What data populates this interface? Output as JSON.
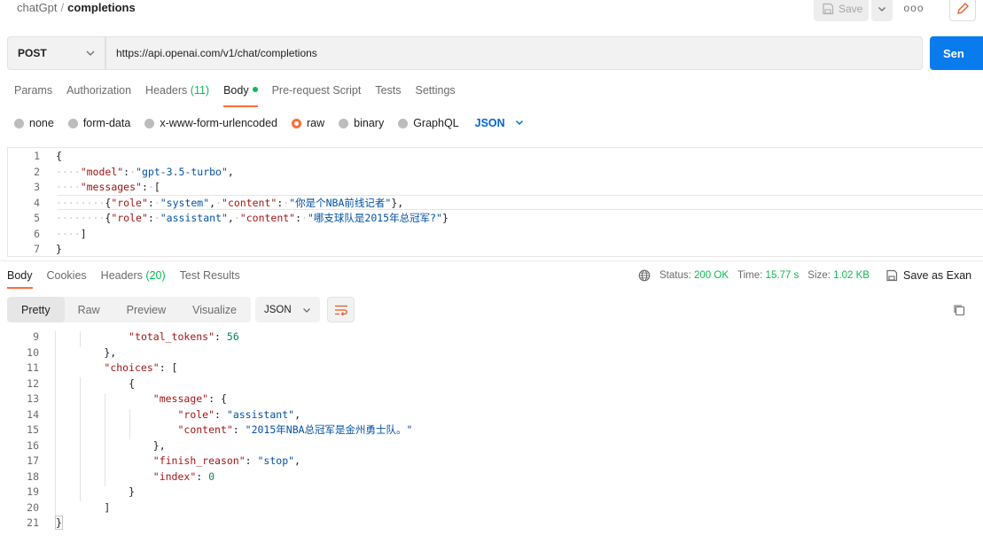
{
  "breadcrumb": {
    "parent": "chatGpt",
    "separator": "/",
    "current": "completions"
  },
  "toolbar": {
    "save_label": "Save",
    "more_label": "ooo"
  },
  "request": {
    "method": "POST",
    "url": "https://api.openai.com/v1/chat/completions",
    "send_label": "Sen"
  },
  "request_tabs": [
    {
      "label": "Params"
    },
    {
      "label": "Authorization"
    },
    {
      "label": "Headers",
      "count": "(11)"
    },
    {
      "label": "Body",
      "active": true
    },
    {
      "label": "Pre-request Script"
    },
    {
      "label": "Tests"
    },
    {
      "label": "Settings"
    }
  ],
  "body_types": {
    "options": [
      "none",
      "form-data",
      "x-www-form-urlencoded",
      "raw",
      "binary",
      "GraphQL"
    ],
    "selected": "raw",
    "language": "JSON"
  },
  "request_body": {
    "line_numbers": [
      "1",
      "2",
      "3",
      "4",
      "5",
      "6",
      "7"
    ],
    "model_key": "\"model\"",
    "model_value": "\"gpt-3.5-turbo\"",
    "messages_key": "\"messages\"",
    "role_key": "\"role\"",
    "content_key": "\"content\"",
    "msg1_role": "\"system\"",
    "msg1_content": "\"你是个NBA前线记者\"",
    "msg2_role": "\"assistant\"",
    "msg2_content": "\"哪支球队是2015年总冠军?\""
  },
  "response_tabs": [
    {
      "label": "Body",
      "active": true
    },
    {
      "label": "Cookies"
    },
    {
      "label": "Headers",
      "count": "(20)"
    },
    {
      "label": "Test Results"
    }
  ],
  "response_meta": {
    "status_label": "Status:",
    "status_value": "200 OK",
    "time_label": "Time:",
    "time_value": "15.77 s",
    "size_label": "Size:",
    "size_value": "1.02 KB",
    "save_as_label": "Save as Exan"
  },
  "response_views": [
    "Pretty",
    "Raw",
    "Preview",
    "Visualize"
  ],
  "response_format": "JSON",
  "response_body": {
    "line_numbers": [
      "9",
      "10",
      "11",
      "12",
      "13",
      "14",
      "15",
      "16",
      "17",
      "18",
      "19",
      "20",
      "21"
    ],
    "total_tokens_key": "\"total_tokens\"",
    "total_tokens_value": "56",
    "choices_key": "\"choices\"",
    "message_key": "\"message\"",
    "role_key": "\"role\"",
    "role_value": "\"assistant\"",
    "content_key": "\"content\"",
    "content_value": "\"2015年NBA总冠军是金州勇士队。\"",
    "finish_reason_key": "\"finish_reason\"",
    "finish_reason_value": "\"stop\"",
    "index_key": "\"index\"",
    "index_value": "0"
  }
}
